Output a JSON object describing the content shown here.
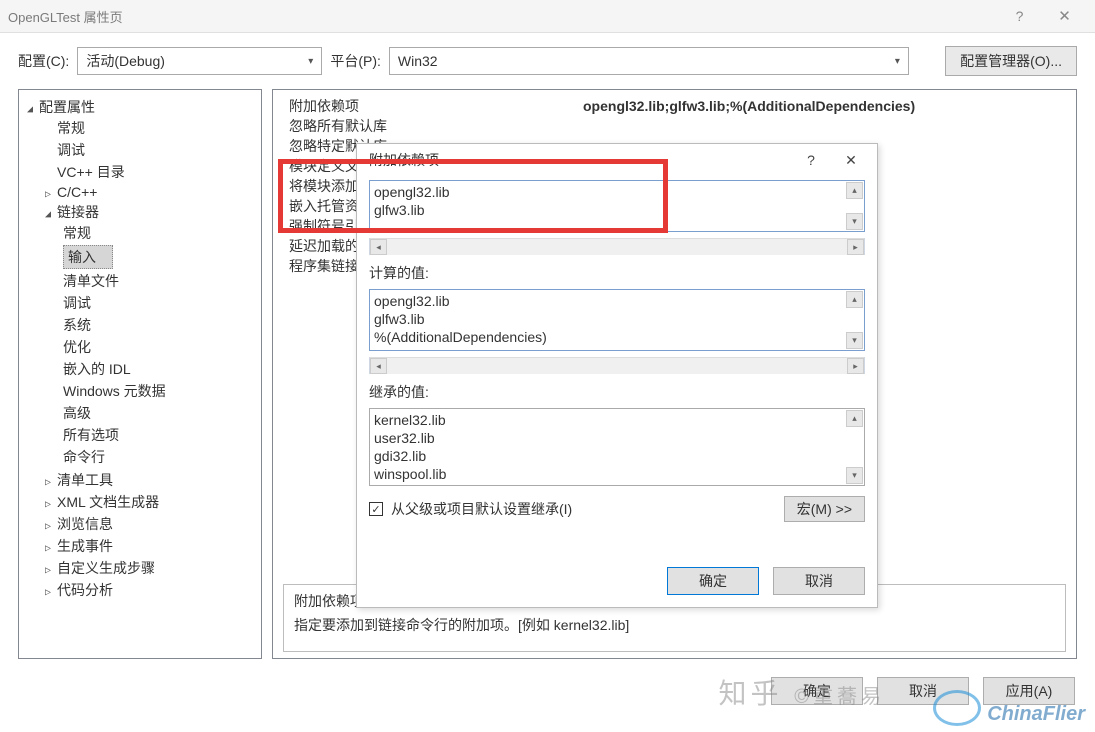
{
  "window": {
    "title": "OpenGLTest 属性页"
  },
  "toolbar": {
    "config_label": "配置(C):",
    "config_value": "活动(Debug)",
    "platform_label": "平台(P):",
    "platform_value": "Win32",
    "manager_label": "配置管理器(O)..."
  },
  "tree": {
    "root": "配置属性",
    "items": [
      "常规",
      "调试",
      "VC++ 目录"
    ],
    "cpp": "C/C++",
    "linker": {
      "label": "链接器",
      "children": [
        "常规",
        "输入",
        "清单文件",
        "调试",
        "系统",
        "优化",
        "嵌入的 IDL",
        "Windows 元数据",
        "高级",
        "所有选项",
        "命令行"
      ]
    },
    "rest": [
      "清单工具",
      "XML 文档生成器",
      "浏览信息",
      "生成事件",
      "自定义生成步骤",
      "代码分析"
    ]
  },
  "props": {
    "rows": [
      {
        "label": "附加依赖项",
        "value": "opengl32.lib;glfw3.lib;%(AdditionalDependencies)"
      },
      {
        "label": "忽略所有默认库",
        "value": ""
      },
      {
        "label": "忽略特定默认库",
        "value": ""
      },
      {
        "label": "模块定义文件",
        "value": ""
      },
      {
        "label": "将模块添加到程序集",
        "value": ""
      },
      {
        "label": "嵌入托管资源文件",
        "value": ""
      },
      {
        "label": "强制符号引用",
        "value": ""
      },
      {
        "label": "延迟加载的 DLL",
        "value": ""
      },
      {
        "label": "程序集链接资源",
        "value": ""
      }
    ]
  },
  "desc": {
    "title": "附加依赖项",
    "text": "指定要添加到链接命令行的附加项。[例如 kernel32.lib]"
  },
  "footer": {
    "ok": "确定",
    "cancel": "取消",
    "apply": "应用(A)"
  },
  "dialog": {
    "title": "附加依赖项",
    "edit_lines": [
      "opengl32.lib",
      "glfw3.lib"
    ],
    "calc_label": "计算的值:",
    "calc_lines": [
      "opengl32.lib",
      "glfw3.lib",
      "%(AdditionalDependencies)"
    ],
    "inh_label": "继承的值:",
    "inh_lines": [
      "kernel32.lib",
      "user32.lib",
      "gdi32.lib",
      "winspool.lib"
    ],
    "inherit_check": "从父级或项目默认设置继承(I)",
    "macro": "宏(M) >>",
    "ok": "确定",
    "cancel": "取消"
  },
  "watermark": {
    "brand": "ChinaFlier",
    "zh": "知乎",
    "sub1": "©重蕎易"
  }
}
